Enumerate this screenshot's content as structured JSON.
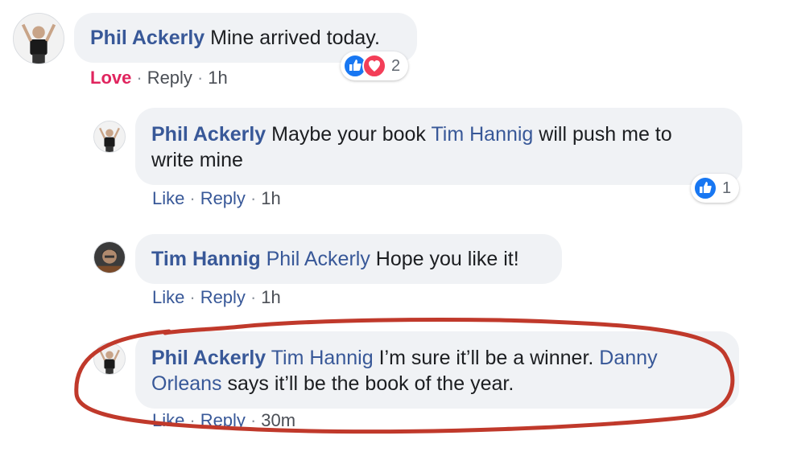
{
  "comments": [
    {
      "author": "Phil Ackerly",
      "text_parts": [
        "Mine arrived today."
      ],
      "actions": {
        "reaction": "Love",
        "reply": "Reply",
        "time": "1h",
        "sep": "·"
      },
      "reactions": {
        "icons": [
          "like-icon",
          "love-icon"
        ],
        "count": "2"
      }
    },
    {
      "author": "Phil Ackerly",
      "text_parts": [
        "Maybe your book",
        "Tim Hannig",
        "will push me to",
        "write mine"
      ],
      "actions": {
        "reaction": "Like",
        "reply": "Reply",
        "time": "1h",
        "sep": "·"
      },
      "reactions": {
        "icons": [
          "like-icon"
        ],
        "count": "1"
      }
    },
    {
      "author": "Tim Hannig",
      "text_parts": [
        "Phil Ackerly",
        "Hope you like it!"
      ],
      "actions": {
        "reaction": "Like",
        "reply": "Reply",
        "time": "1h",
        "sep": "·"
      }
    },
    {
      "author": "Phil Ackerly",
      "text_parts": [
        "Tim Hannig",
        "I’m sure it’ll be a winner.",
        "Danny",
        "Orleans",
        "says it’ll be the book of the year."
      ],
      "actions": {
        "reaction": "Like",
        "reply": "Reply",
        "time": "30m",
        "sep": "·"
      }
    }
  ],
  "colors": {
    "author": "#385898",
    "bubble": "#f0f2f5",
    "love": "#e0245e",
    "like_icon": "#1877f2",
    "annotation": "#c0392b"
  }
}
